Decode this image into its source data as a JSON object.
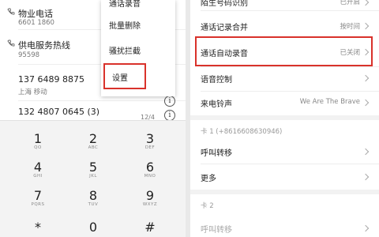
{
  "left": {
    "contacts": [
      {
        "name": "物业电话",
        "sub": "6601 1860"
      },
      {
        "name": "供电服务热线",
        "sub": "95598"
      },
      {
        "name": "137 6489 8875",
        "sub": "上海 移动"
      },
      {
        "name": "132 4807 0645 (3)",
        "sub": "",
        "date": "12/4"
      }
    ],
    "menu": {
      "items": [
        "通话录音",
        "批量删除",
        "骚扰拦截",
        "设置"
      ]
    },
    "dialpad": [
      {
        "num": "1",
        "letters": "QO"
      },
      {
        "num": "2",
        "letters": "ABC"
      },
      {
        "num": "3",
        "letters": "DEF"
      },
      {
        "num": "4",
        "letters": "GHI"
      },
      {
        "num": "5",
        "letters": "JKL"
      },
      {
        "num": "6",
        "letters": "MNO"
      },
      {
        "num": "7",
        "letters": "PQRS"
      },
      {
        "num": "8",
        "letters": "TUV"
      },
      {
        "num": "9",
        "letters": "WXYZ"
      },
      {
        "num": "*",
        "letters": ""
      },
      {
        "num": "0",
        "letters": ""
      },
      {
        "num": "#",
        "letters": ""
      }
    ]
  },
  "right": {
    "rows": [
      {
        "label": "陌生号码识别",
        "value": "已开启"
      },
      {
        "label": "通话记录合并",
        "value": "按时间"
      },
      {
        "label": "通话自动录音",
        "value": "已关闭"
      },
      {
        "label": "语音控制",
        "value": ""
      },
      {
        "label": "来电铃声",
        "value": "We Are The Brave"
      }
    ],
    "sim1_header": "卡 1 (+8616608630946)",
    "sim1_rows": [
      {
        "label": "呼叫转移"
      },
      {
        "label": "更多"
      }
    ],
    "sim2_header": "卡 2",
    "sim2_rows": [
      {
        "label": "呼叫转移"
      }
    ]
  },
  "highlight_color": "#d9322b"
}
